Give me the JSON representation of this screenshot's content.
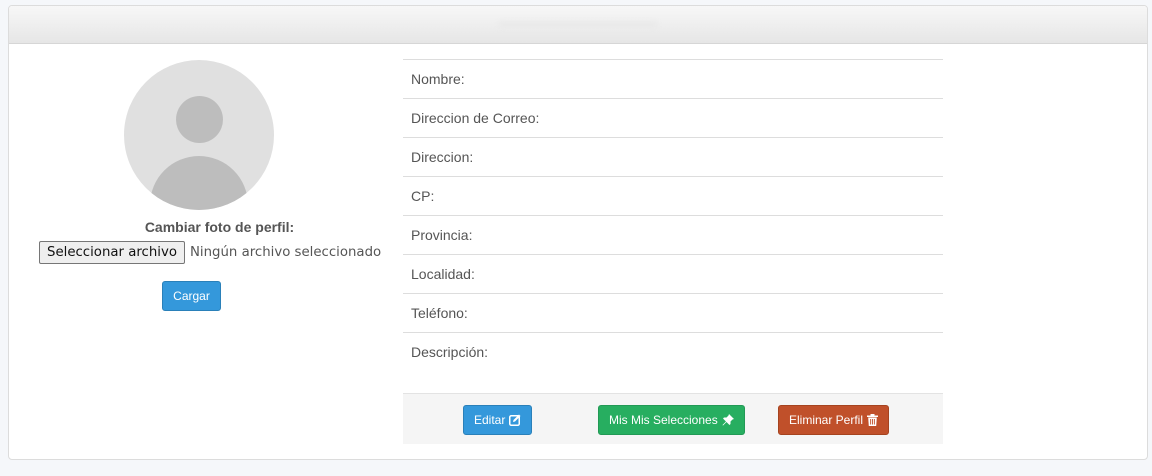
{
  "profile_photo": {
    "label": "Cambiar foto de perfil:",
    "file_button_label": "Seleccionar archivo",
    "file_status": "Ningún archivo seleccionado",
    "upload_button_label": "Cargar"
  },
  "fields": [
    {
      "label": "Nombre:"
    },
    {
      "label": "Direccion de Correo:"
    },
    {
      "label": "Direccion:"
    },
    {
      "label": "CP:"
    },
    {
      "label": "Provincia:"
    },
    {
      "label": "Localidad:"
    },
    {
      "label": "Teléfono:"
    },
    {
      "label": "Descripción:"
    }
  ],
  "actions": {
    "edit_label": "Editar",
    "edit_icon": "edit-icon",
    "selections_label": "Mis Mis Selecciones",
    "selections_icon": "pin-icon",
    "delete_label": "Eliminar Perfil",
    "delete_icon": "trash-icon"
  },
  "colors": {
    "primary": "#3498db",
    "success": "#27ae60",
    "danger": "#c0502a"
  }
}
